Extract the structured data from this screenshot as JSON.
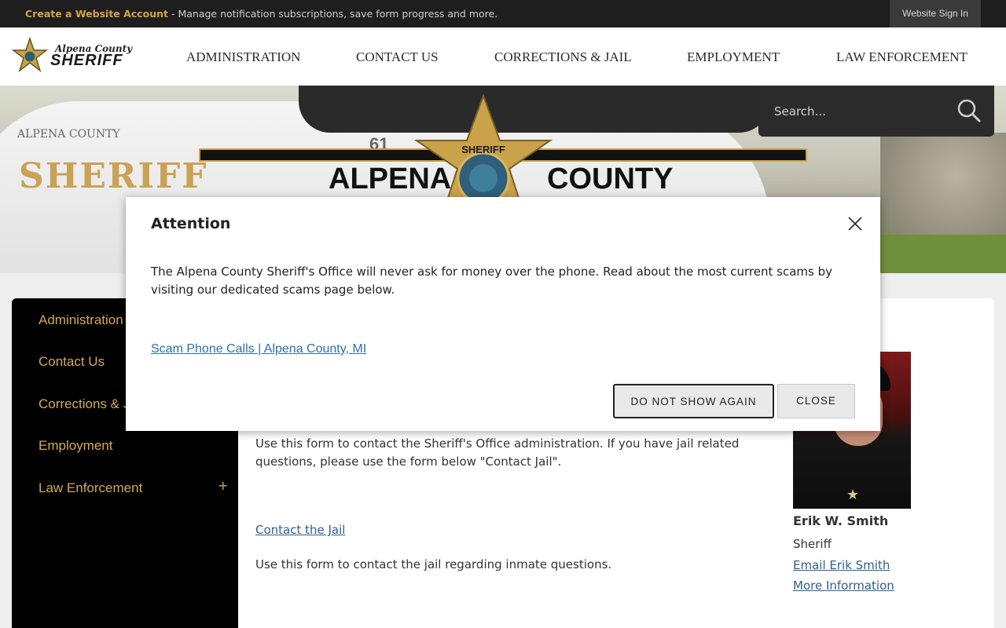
{
  "topbar": {
    "account_link": "Create a Website Account",
    "account_desc": " - Manage notification subscriptions, save form progress and more.",
    "signin": "Website Sign In"
  },
  "logo": {
    "line1": "Alpena County",
    "line2": "SHERIFF"
  },
  "nav": [
    "ADMINISTRATION",
    "CONTACT US",
    "CORRECTIONS & JAIL",
    "EMPLOYMENT",
    "LAW ENFORCEMENT"
  ],
  "banner": {
    "left_small": "ALPENA COUNTY",
    "left_big": "SHERIFF",
    "unit_number": "61",
    "word_left": "ALPENA",
    "word_right": "COUNTY",
    "star_text": "SHERIFF"
  },
  "search": {
    "placeholder": "Search..."
  },
  "sidebar": {
    "items": [
      "Administration",
      "Contact Us",
      "Corrections & Jail",
      "Employment",
      "Law Enforcement"
    ],
    "expand_symbol": "+"
  },
  "content": {
    "admin_text": "Use this form to contact the Sheriff's Office administration. If you have jail related questions, please use the form below \"Contact Jail\".",
    "jail_link": "Contact the Jail",
    "jail_text": "Use this form to contact the jail regarding inmate questions."
  },
  "profile": {
    "name": "Erik W. Smith",
    "title": "Sheriff",
    "email_link": "Email Erik Smith",
    "more_link": "More Information"
  },
  "modal": {
    "title": "Attention",
    "body": "The Alpena County Sheriff's Office will never ask for money over the phone. Read about the most current scams by visiting our dedicated scams page below.",
    "link": "Scam Phone Calls | Alpena County, MI",
    "dont_show": "DO NOT SHOW AGAIN",
    "close": "CLOSE"
  },
  "colors": {
    "accent_gold": "#d4aa55",
    "link_blue": "#2f5f8f",
    "topbar_bg": "#1e1e1e",
    "sidebar_bg": "#000000"
  }
}
